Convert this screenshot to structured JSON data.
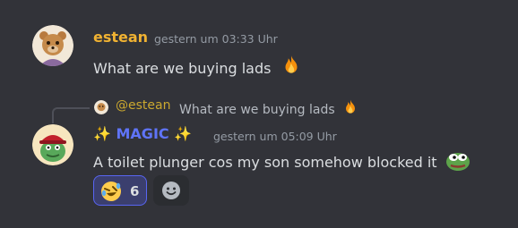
{
  "messages": [
    {
      "username": "estean",
      "username_color": "#f0b232",
      "timestamp": "gestern um 03:33 Uhr",
      "text": "What are we buying lads",
      "emoji": "fire-emoji"
    },
    {
      "reply": {
        "mention": "@estean",
        "text": "What are we buying lads",
        "emoji": "fire-emoji"
      },
      "username_prefix": "✨",
      "username": "MAGIC",
      "username_suffix": "✨",
      "username_color": "#5f74f7",
      "timestamp": "gestern um 05:09 Uhr",
      "text": "A toilet plunger cos my son somehow blocked it",
      "emoji": "pepe-frog-emoji",
      "reactions": [
        {
          "emoji": "rofl-emoji",
          "count": "6",
          "active": true
        }
      ],
      "add_reaction_icon": "add-reaction-smiley-icon"
    }
  ],
  "colors": {
    "background": "#323339",
    "text": "#dbdee1",
    "muted": "#949ba4",
    "reaction_border": "#5865f2",
    "reaction_bg": "#3b3f6e"
  }
}
